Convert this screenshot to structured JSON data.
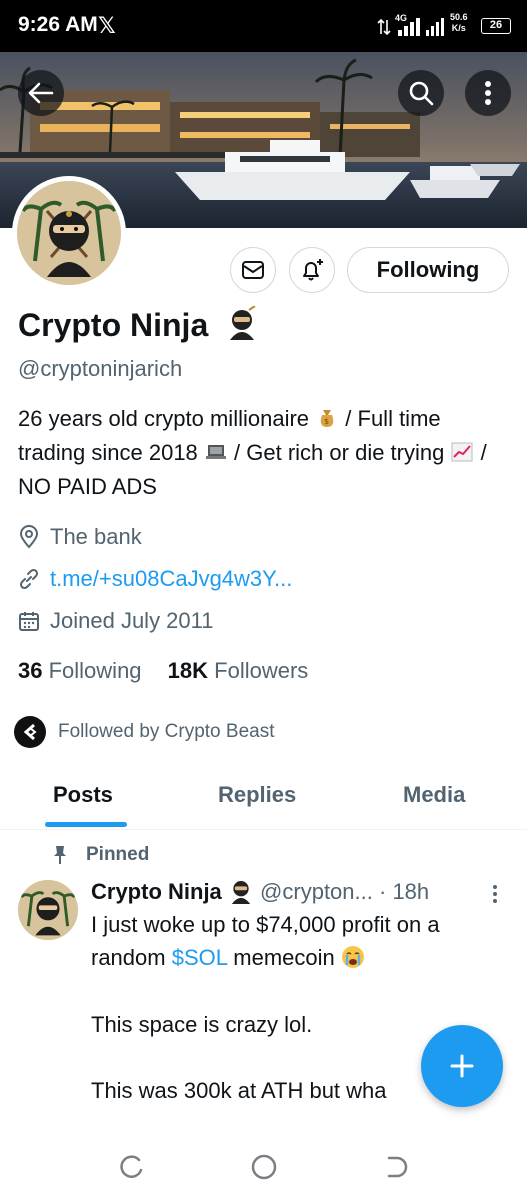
{
  "status_bar": {
    "time": "9:26 AM",
    "x_logo": "𝕏",
    "network": "4G",
    "speed_value": "50.6",
    "speed_unit": "K/s",
    "battery": "26"
  },
  "header": {
    "back_icon": "arrow-left-icon",
    "search_icon": "search-icon",
    "more_icon": "more-vertical-icon"
  },
  "actions": {
    "messages_icon": "envelope-icon",
    "notify_icon": "bell-plus-icon",
    "following_label": "Following"
  },
  "profile": {
    "name": "Crypto Ninja",
    "handle": "@cryptoninjarich",
    "bio_1": "26 years old crypto millionaire",
    "bio_2": "/ Full time trading since 2018",
    "bio_3": "/ Get rich or die trying",
    "bio_4": "/ NO PAID ADS",
    "location": "The bank",
    "url": "t.me/+su08CaJvg4w3Y...",
    "joined": "Joined July 2011",
    "following_count": "36",
    "following_label": "Following",
    "followers_count": "18K",
    "followers_label": "Followers",
    "followed_by": "Followed by Crypto Beast"
  },
  "tabs": [
    {
      "label": "Posts",
      "active": true
    },
    {
      "label": "Replies",
      "active": false
    },
    {
      "label": "Media",
      "active": false
    }
  ],
  "post": {
    "pinned_label": "Pinned",
    "author": "Crypto Ninja",
    "handle": "@crypton...",
    "time": "· 18h",
    "line1": "I just woke up to $74,000 profit on a random",
    "cashtag": "$SOL",
    "line1_end": "memecoin",
    "line2": "This space is crazy lol.",
    "line3": "This was 300k at ATH but wha"
  },
  "fab": {
    "label": "+"
  },
  "colors": {
    "accent": "#1d9bf0",
    "text": "#0f1419",
    "muted": "#536471"
  }
}
